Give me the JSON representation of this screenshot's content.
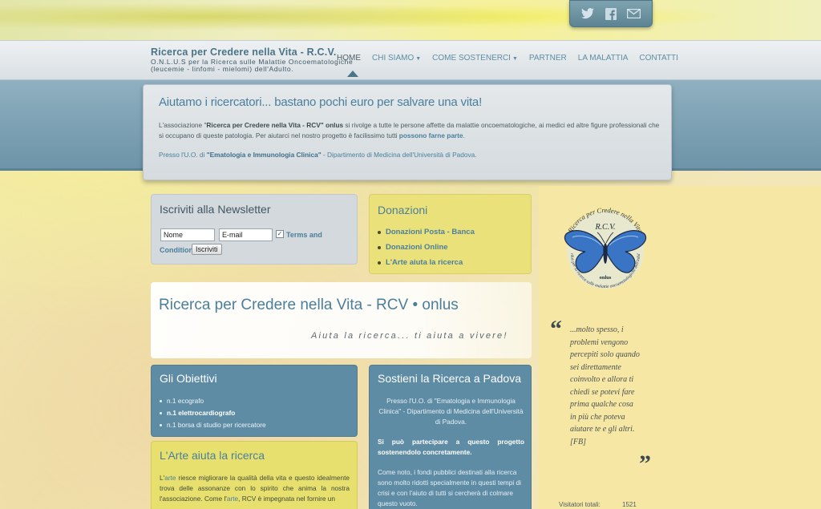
{
  "header": {
    "title": "Ricerca per Credere nella Vita - R.C.V.",
    "subtitle_line1": "O.N.L.U.S per la Ricerca sulle Malattie Oncoematologiche",
    "subtitle_line2": "(leucemie - linfomi - mielomi) dell'Adulto."
  },
  "social": {
    "twitter_icon": "twitter-icon",
    "facebook_icon": "facebook-icon",
    "email_icon": "email-icon"
  },
  "nav": {
    "items": [
      {
        "label": "HOME",
        "active": true,
        "dropdown": false
      },
      {
        "label": "CHI SIAMO",
        "active": false,
        "dropdown": true
      },
      {
        "label": "COME SOSTENERCI",
        "active": false,
        "dropdown": true
      },
      {
        "label": "PARTNER",
        "active": false,
        "dropdown": false
      },
      {
        "label": "LA MALATTIA",
        "active": false,
        "dropdown": false
      },
      {
        "label": "CONTATTI",
        "active": false,
        "dropdown": false
      }
    ]
  },
  "intro": {
    "title": "Aiutamo i ricercatori... bastano pochi euro per salvare una vita!",
    "text_pre": "L'associazione \"",
    "text_bold": "Ricerca per Credere nella Vita - RCV\" onlus",
    "text_mid": " si rivolge a tutte le persone affette da malattie oncoematologiche, ai medici ed altre figure professionali che si occupano di queste patologia. Per aiutarci nel nostro progetto è facilissimo tutti ",
    "text_link": "possono farne parte",
    "text_end": ".",
    "loc_pre": "Presso l'U.O. di ",
    "loc_bold": "\"Ematologia e Immunologia Clinica\"",
    "loc_end": " - Dipartimento di Medicina dell'Università di Padova."
  },
  "newsletter": {
    "title": "Iscriviti alla Newsletter",
    "name_value": "Nome",
    "email_value": "E-mail",
    "terms_part1": "Terms and",
    "terms_part2": "Condition",
    "submit_label": "Iscriviti"
  },
  "donations": {
    "title": "Donazioni",
    "items": [
      "Donazioni Posta - Banca",
      "Donazioni Online",
      "L'Arte aiuta la ricerca"
    ]
  },
  "hero": {
    "title": "Ricerca per Credere nella Vita - RCV • onlus",
    "tagline": "Aiuta la ricerca... ti aiuta a vivere!"
  },
  "objectives": {
    "title": "Gli Obiettivi",
    "items": [
      "n.1 ecografo",
      "n.1 elettrocardiografo",
      "n.1 borsa di studio per ricercatore"
    ]
  },
  "arte": {
    "title": "L'Arte aiuta la ricerca",
    "p_pre": "L'",
    "p_link1": "arte",
    "p_mid": " riesce migliorare la qualità della vita e questo idealmente trova delle assonanze con lo spirito che anima la nostra l'associazione. Come l'",
    "p_link2": "arte",
    "p_end": ", RCV è impegnata nel fornire un"
  },
  "support": {
    "title": "Sostieni la Ricerca a Padova",
    "p1": "Presso l'U.O. di \"Ematologia e Immunologia Clinica\" - Dipartimento di Medicina dell'Università di Padova.",
    "p2": "Si può partecipare a questo progetto sostenendolo concretamente.",
    "p3": "Come noto, i fondi pubblici destinati alla ricerca sono molto ridotti specialmente in questi tempi di crisi e con l'aiuto di tutti si cercherà di colmare questo vuoto."
  },
  "sidebar": {
    "badge_top": "Ricerca per Credere nella Vita",
    "badge_center": "R.C.V.",
    "badge_bottom": "onlus",
    "badge_ring": "Onlus per la ricerca sulle malattie oncoematologiche dell'adulto",
    "quote": "...molto spesso, i problemi vengono percepiti solo quando sei direttamente coinvolto e allora ti chiedi se potevi fare prima qualche cosa in più che poteva aiutare te e gli altri. [FB]",
    "visitors_label": "Visitatori totali:",
    "visitors_value": "1521"
  },
  "colors": {
    "accent_blue": "#4a7f9c",
    "box_blue": "#5e8ca5",
    "box_yellow": "#ebe17a"
  }
}
